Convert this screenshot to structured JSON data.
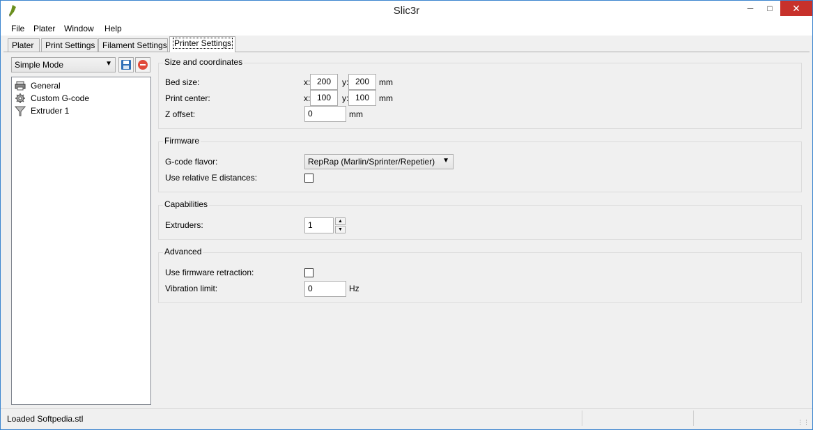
{
  "window": {
    "title": "Slic3r"
  },
  "menu": [
    "File",
    "Plater",
    "Window",
    "Help"
  ],
  "tabs": [
    "Plater",
    "Print Settings",
    "Filament Settings",
    "Printer Settings"
  ],
  "active_tab": "Printer Settings",
  "left_panel": {
    "mode": "Simple Mode",
    "tree": [
      "General",
      "Custom G-code",
      "Extruder 1"
    ]
  },
  "size": {
    "title": "Size and coordinates",
    "bed_label": "Bed size:",
    "bed_x": "200",
    "bed_y": "200",
    "center_label": "Print center:",
    "center_x": "100",
    "center_y": "100",
    "x_axis": "x:",
    "y_axis": "y:",
    "unit_mm": "mm",
    "zoffset_label": "Z offset:",
    "zoffset": "0"
  },
  "firmware": {
    "title": "Firmware",
    "flavor_label": "G-code flavor:",
    "flavor": "RepRap (Marlin/Sprinter/Repetier)",
    "relative_label": "Use relative E distances:",
    "relative_checked": false
  },
  "capabilities": {
    "title": "Capabilities",
    "extruders_label": "Extruders:",
    "extruders": "1"
  },
  "advanced": {
    "title": "Advanced",
    "retraction_label": "Use firmware retraction:",
    "retraction_checked": false,
    "vibration_label": "Vibration limit:",
    "vibration": "0",
    "unit_hz": "Hz"
  },
  "status": {
    "text": "Loaded Softpedia.stl"
  },
  "window_buttons": {
    "minimize": "─",
    "maximize": "□",
    "close": "✕"
  },
  "colors": {
    "accent": "#3a84cf",
    "close": "#c7312b"
  }
}
